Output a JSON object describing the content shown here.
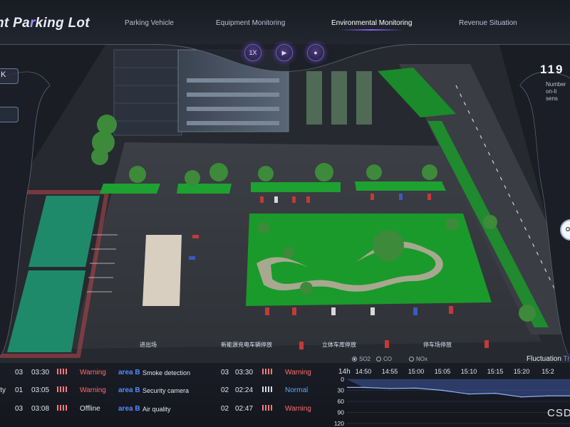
{
  "header": {
    "title_main": "nt Pa",
    "title_accent": "r",
    "title_rest": "king Lot",
    "tabs": [
      {
        "label": "Parking Vehicle",
        "active": false
      },
      {
        "label": "Equipment Monitoring",
        "active": false
      },
      {
        "label": "Environmental Monitoring",
        "active": true
      },
      {
        "label": "Revenue Situation",
        "active": false
      }
    ]
  },
  "controls": {
    "buttons": [
      {
        "label": "1X",
        "icon": "speed-icon"
      },
      {
        "label": "▶",
        "icon": "play-icon"
      },
      {
        "label": "●",
        "icon": "record-icon"
      }
    ]
  },
  "stats": {
    "value": "119",
    "description_lines": [
      "Number",
      "on-li",
      "sens"
    ]
  },
  "left_controls": {
    "top_glyph": "K"
  },
  "right_knob": {
    "label": "O"
  },
  "scene_labels": [
    "进出场",
    "新能源充电车辆停放",
    "立体车库停放",
    "停车场停放"
  ],
  "alarms": {
    "left": [
      {
        "prefix": "",
        "id": "03",
        "time": "03:30",
        "status": "Warning",
        "level": "warn",
        "area": "area B",
        "desc": "Smoke detection"
      },
      {
        "prefix": "ity",
        "id": "01",
        "time": "03:05",
        "status": "Warning",
        "level": "warn",
        "area": "area B",
        "desc": "Security camera"
      },
      {
        "prefix": "",
        "id": "03",
        "time": "03:08",
        "status": "Offline",
        "level": "off",
        "area": "area B",
        "desc": "Air quality"
      }
    ],
    "right": [
      {
        "id": "03",
        "time": "03:30",
        "status": "Warning",
        "level": "warn"
      },
      {
        "id": "02",
        "time": "02:24",
        "status": "Normal",
        "level": "normal"
      },
      {
        "id": "02",
        "time": "02:47",
        "status": "Warning",
        "level": "warn"
      }
    ]
  },
  "watermark": "CSD",
  "colors": {
    "warning": "#ff6b6b",
    "normal": "#5aa9ff",
    "area": "#4f8dff",
    "accent": "#8b5cf6",
    "chart_line": "#8fb4ff"
  },
  "chart_data": {
    "type": "area",
    "title": "Fluctuation Tre",
    "title_highlight": "Tre",
    "title_plain": "Fluctuation ",
    "legend": [
      {
        "name": "SO2",
        "selected": true
      },
      {
        "name": "CO",
        "selected": false
      },
      {
        "name": "NOx",
        "selected": false
      }
    ],
    "x_unit_label": "14h",
    "x": [
      "14:50",
      "14:55",
      "15:00",
      "15:05",
      "15:10",
      "15:15",
      "15:20",
      "15:2"
    ],
    "y_ticks": [
      0,
      30,
      60,
      90,
      120
    ],
    "ylim": [
      0,
      120
    ],
    "y_inverted": true,
    "series": [
      {
        "name": "SO2",
        "values": [
          22,
          25,
          24,
          30,
          40,
          38,
          48,
          45
        ]
      }
    ]
  }
}
